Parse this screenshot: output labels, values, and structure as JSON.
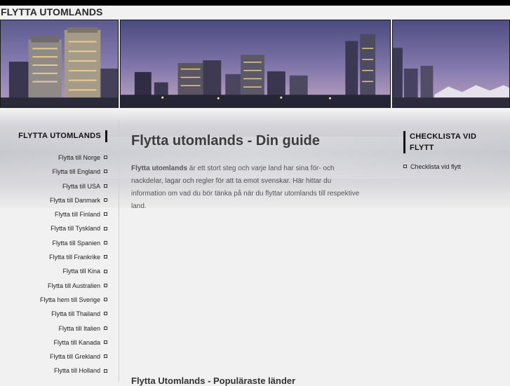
{
  "site": {
    "title": "FLYTTA UTOMLANDS"
  },
  "nav": {
    "heading": "FLYTTA UTOMLANDS",
    "items": [
      "Flytta till Norge",
      "Flytta till England",
      "Flytta till USA",
      "Flytta till Danmark",
      "Flytta till Finland",
      "Flytta till Tyskland",
      "Flytta till Spanien",
      "Flytta till Frankrike",
      "Flytta till Kina",
      "Flytta till Australien",
      "Flytta hem till Sverige",
      "Flytta till Thailand",
      "Flytta till Italien",
      "Flytta till Kanada",
      "Flytta till Grekland",
      "Flytta till Holland"
    ]
  },
  "main": {
    "heading": "Flytta utomlands - Din guide",
    "intro_bold": "Flytta utomlands",
    "intro_rest": " är ett stort steg och varje land har sina för- och nackdelar, lagar och regler för att ta emot svenskar. Här hittar du information om vad du bör tänka på när du flyttar utomlands till respektive land.",
    "subheading": "Flytta Utomlands - Populäraste länder"
  },
  "right": {
    "heading": "CHECKLISTA VID FLYTT",
    "items": [
      "Checklista vid flytt"
    ]
  },
  "colors": {
    "accent": "#111111",
    "background": "#f1f1f1"
  }
}
